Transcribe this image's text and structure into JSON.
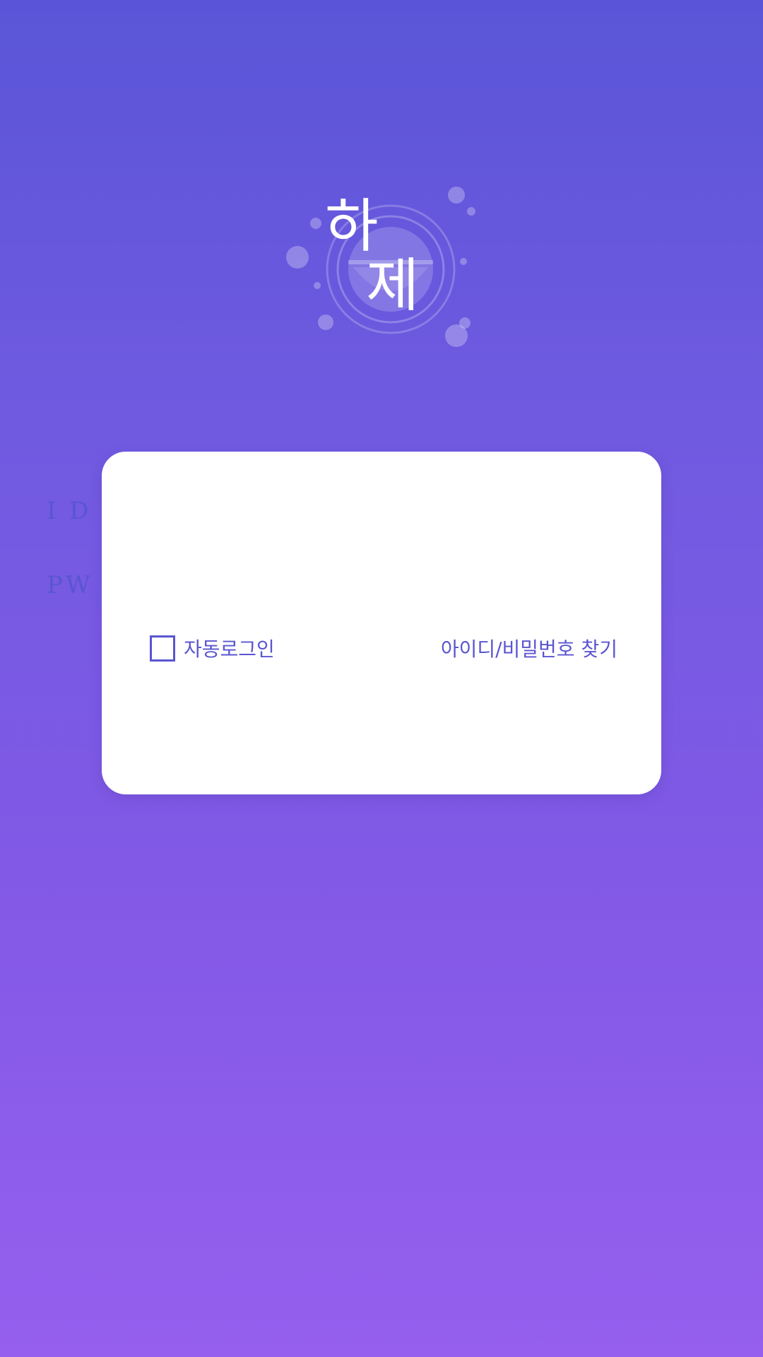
{
  "logo": {
    "text_top": "하",
    "text_bottom": "제",
    "icon": "bubble-emblem-logo"
  },
  "login": {
    "id_label": "I D",
    "id_value": "",
    "pw_label": "PW",
    "pw_value": "",
    "auto_login_label": "자동로그인",
    "auto_login_checked": false,
    "find_account_label": "아이디/비밀번호 찾기"
  },
  "colors": {
    "accent": "#5a55d0",
    "background_top": "#5a55d8",
    "background_bottom": "#965fee",
    "card": "#ffffff"
  }
}
